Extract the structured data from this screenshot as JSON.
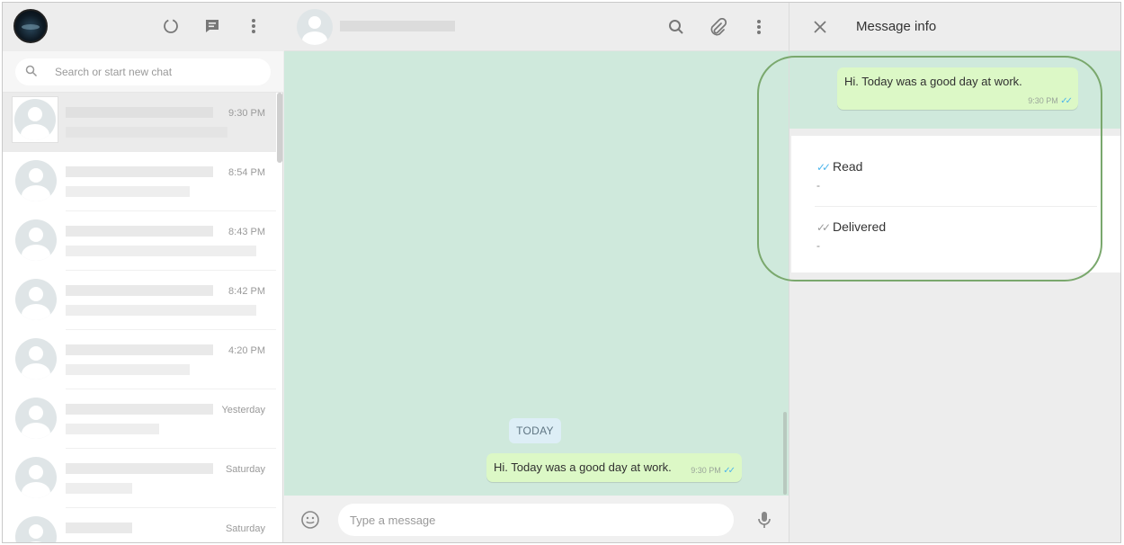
{
  "sidebar": {
    "search": {
      "placeholder": "Search or start new chat"
    },
    "chats": [
      {
        "time": "9:30 PM",
        "active": true
      },
      {
        "time": "8:54 PM"
      },
      {
        "time": "8:43 PM"
      },
      {
        "time": "8:42 PM"
      },
      {
        "time": "4:20 PM"
      },
      {
        "time": "Yesterday"
      },
      {
        "time": "Saturday"
      },
      {
        "time": "Saturday"
      }
    ]
  },
  "conversation": {
    "date_chip": "TODAY",
    "message": {
      "text": "Hi. Today was a good day at work.",
      "time": "9:30 PM",
      "status": "read"
    },
    "composer": {
      "placeholder": "Type a message"
    }
  },
  "message_info": {
    "title": "Message info",
    "preview": {
      "text": "Hi. Today was a good day at work.",
      "time": "9:30 PM"
    },
    "read": {
      "label": "Read",
      "value": "-"
    },
    "delivered": {
      "label": "Delivered",
      "value": "-"
    }
  },
  "colors": {
    "conversation_bg": "#cfe9dc",
    "bubble_out": "#dcf8c6",
    "read_tick": "#4fb6ec",
    "highlight": "#7aa86d"
  },
  "icons": [
    "status-icon",
    "new-chat-icon",
    "menu-icon",
    "search-icon",
    "attach-icon",
    "emoji-icon",
    "mic-icon",
    "close-icon",
    "double-tick-icon"
  ]
}
